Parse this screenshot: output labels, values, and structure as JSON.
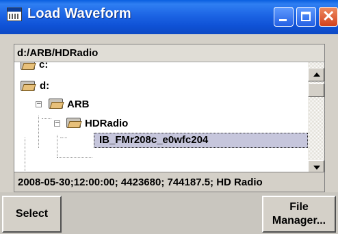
{
  "window": {
    "title": "Load Waveform"
  },
  "path": "d:/ARB/HDRadio",
  "tree": {
    "drive_c": "c:",
    "drive_d": "d:",
    "folder_arb": "ARB",
    "folder_hdradio": "HDRadio",
    "selected_file": "IB_FMr208c_e0wfc204"
  },
  "info": "2008-05-30;12:00:00; 4423680; 744187.5; HD Radio",
  "buttons": {
    "select": "Select",
    "file_manager_line1": "File",
    "file_manager_line2": "Manager..."
  }
}
